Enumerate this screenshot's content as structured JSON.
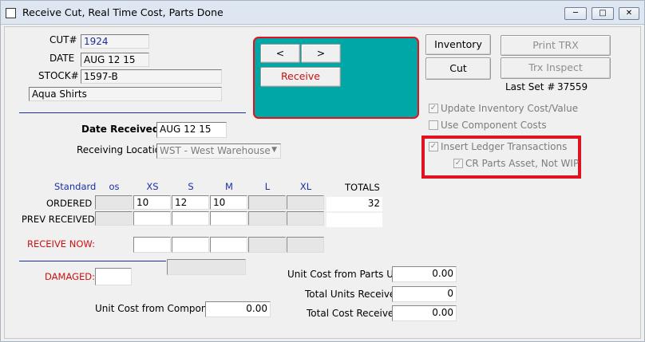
{
  "window": {
    "title": "Receive Cut, Real Time Cost, Parts Done"
  },
  "header": {
    "cut_label": "CUT#",
    "cut_value": "1924",
    "date_label": "DATE",
    "date_value": "AUG 12 15",
    "stock_label": "STOCK#",
    "stock_value": "1597-B",
    "description": "Aqua Shirts"
  },
  "nav": {
    "prev": "<",
    "next": ">",
    "receive": "Receive"
  },
  "actions": {
    "inventory": "Inventory",
    "cut": "Cut",
    "print_trx": "Print TRX",
    "trx_inspect": "Trx Inspect",
    "last_set_label": "Last Set #",
    "last_set_value": "37559"
  },
  "options": {
    "update_inventory": {
      "label": "Update Inventory Cost/Value",
      "checked": true
    },
    "use_component_costs": {
      "label": "Use Component Costs",
      "checked": false
    },
    "insert_ledger": {
      "label": "Insert Ledger Transactions",
      "checked": true
    },
    "cr_parts_asset": {
      "label": "CR Parts Asset, Not WIP",
      "checked": true
    }
  },
  "receiving": {
    "date_received_label": "Date Received",
    "date_received_value": "AUG 12 15",
    "location_label": "Receiving Location",
    "location_value": "WST - West Warehouse"
  },
  "grid": {
    "scale_label": "Standard",
    "sizes": [
      "os",
      "XS",
      "S",
      "M",
      "L",
      "XL"
    ],
    "totals_label": "TOTALS",
    "ordered_label": "ORDERED",
    "ordered": [
      "",
      "10",
      "12",
      "10",
      "",
      ""
    ],
    "ordered_total": "32",
    "prev_label": "PREV RECEIVED",
    "receive_now_label": "RECEIVE NOW:"
  },
  "damaged_label": "DAMAGED:",
  "costs": {
    "components_label": "Unit Cost from Components",
    "components_value": "0.00",
    "parts_label": "Unit Cost from Parts Used",
    "parts_value": "0.00",
    "units_label": "Total Units Received",
    "units_value": "0",
    "total_cost_label": "Total Cost Received",
    "total_cost_value": "0.00"
  },
  "colors": {
    "highlight": "#e0141e",
    "panel": "#00a7a7",
    "label_blue": "#1b2fa8",
    "label_red": "#cc1111"
  }
}
